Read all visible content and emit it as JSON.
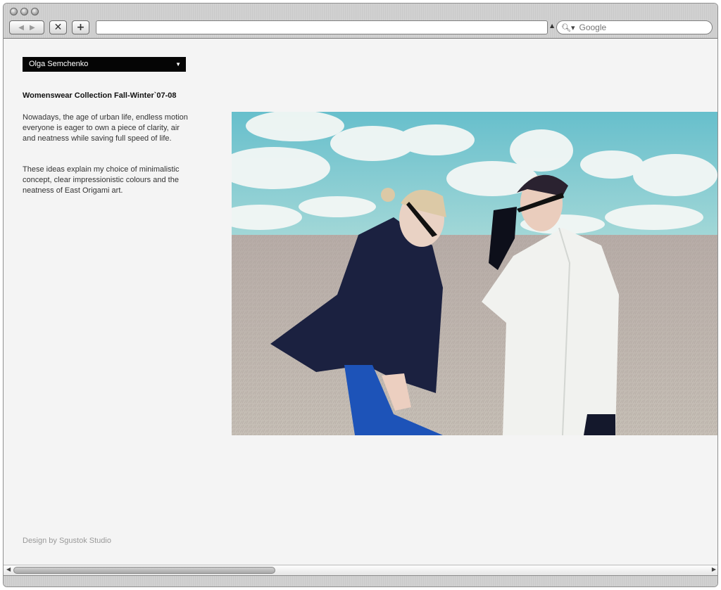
{
  "browser": {
    "back_label": "◀",
    "forward_label": "▶",
    "stop_label": "✕",
    "add_tab_label": "+",
    "url_value": "",
    "search_placeholder": "Google"
  },
  "page": {
    "selector_label": "Olga Semchenko",
    "heading": "Womenswear Collection Fall-Winter`07-08",
    "paragraph1": "Nowadays, the age of urban life, endless motion everyone is eager to own a piece of clarity, air and neatness while saving full speed of life.",
    "paragraph2": "These ideas explain my choice of minimalistic concept, clear impressionistic colours and the neatness of East Origami art.",
    "footer": "Design by Sgustok Studio"
  },
  "colors": {
    "sky": "#7ec8cf",
    "field": "#b8aea6",
    "dark_coat": "#1b2140",
    "white_coat": "#f1f2ef",
    "blue_pants": "#1d53b8"
  }
}
